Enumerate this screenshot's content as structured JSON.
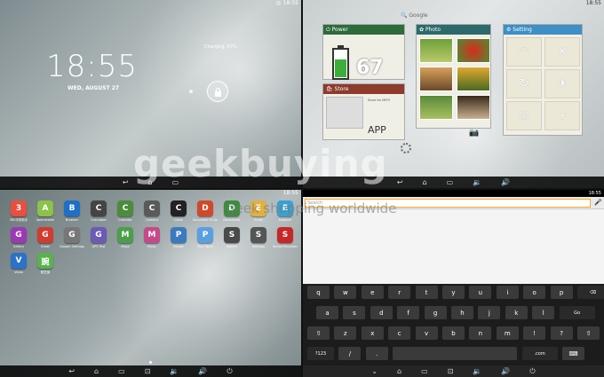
{
  "lock": {
    "time": "18:55",
    "date": "WED, AUGUST 27",
    "charging": "Charging, 67%",
    "lock_icon": "lock-icon"
  },
  "home": {
    "search": "Google",
    "power": {
      "title": "Power",
      "percent": "67"
    },
    "photo": {
      "title": "Photo"
    },
    "setting": {
      "title": "Setting",
      "icons": [
        "wifi",
        "mute",
        "rotate",
        "airplane",
        "power",
        "add"
      ]
    },
    "store": {
      "title": "Store",
      "app_label": "APP",
      "text": "Store for MIPO"
    }
  },
  "apps": [
    {
      "label": "360手机助手",
      "color": "#e94f3f"
    },
    {
      "label": "ApkInstaller",
      "color": "#8bc34a"
    },
    {
      "label": "Browser",
      "color": "#1e6fc7"
    },
    {
      "label": "Calculator",
      "color": "#444444"
    },
    {
      "label": "Calendar",
      "color": "#4c8c3c"
    },
    {
      "label": "Camera",
      "color": "#5a5a5a"
    },
    {
      "label": "Clock",
      "color": "#222222"
    },
    {
      "label": "Document To Go",
      "color": "#d04a2a"
    },
    {
      "label": "Downloads",
      "color": "#3d8b3d"
    },
    {
      "label": "Email",
      "color": "#e0b040"
    },
    {
      "label": "Explorer",
      "color": "#3aa0d0"
    },
    {
      "label": "Gallery",
      "color": "#9b3bb3"
    },
    {
      "label": "Gmail",
      "color": "#d23b2f"
    },
    {
      "label": "Google Settings",
      "color": "#777777"
    },
    {
      "label": "GPS Test",
      "color": "#6b5bb5"
    },
    {
      "label": "Maps",
      "color": "#4aa04a"
    },
    {
      "label": "Music",
      "color": "#c64a8a"
    },
    {
      "label": "People",
      "color": "#3a7bbf"
    },
    {
      "label": "Play Store",
      "color": "#5aa0e0"
    },
    {
      "label": "Search",
      "color": "#4a4a4a"
    },
    {
      "label": "Settings",
      "color": "#555555"
    },
    {
      "label": "Sound Recorder",
      "color": "#c62828"
    },
    {
      "label": "Video",
      "color": "#2b72c9"
    },
    {
      "label": "豌豆荚",
      "color": "#59b24a"
    }
  ],
  "browser": {
    "url_placeholder": "Search",
    "status_time": "18:55",
    "keys_row1": [
      "q",
      "w",
      "e",
      "r",
      "t",
      "y",
      "u",
      "i",
      "o",
      "p",
      "⌫"
    ],
    "keys_row2": [
      "a",
      "s",
      "d",
      "f",
      "g",
      "h",
      "j",
      "k",
      "l",
      "Go"
    ],
    "keys_row3": [
      "⇧",
      "z",
      "x",
      "c",
      "v",
      "b",
      "n",
      "m",
      "!",
      "?",
      "⇧"
    ],
    "keys_row4": [
      "?123",
      "/",
      ".",
      "",
      ".com",
      "⌨"
    ]
  },
  "watermark": {
    "brand": "geekbuying",
    "tagline": "geek shopping worldwide"
  },
  "status_time": "18:55"
}
